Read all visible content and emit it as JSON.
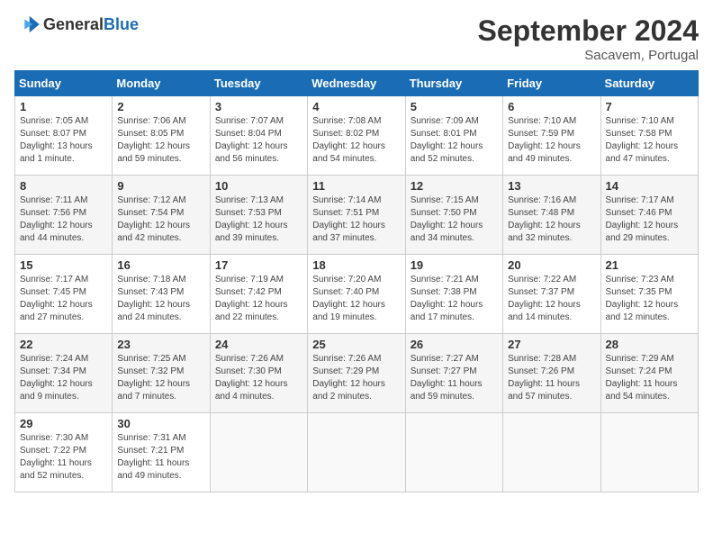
{
  "header": {
    "logo_general": "General",
    "logo_blue": "Blue",
    "month_year": "September 2024",
    "location": "Sacavem, Portugal"
  },
  "days_of_week": [
    "Sunday",
    "Monday",
    "Tuesday",
    "Wednesday",
    "Thursday",
    "Friday",
    "Saturday"
  ],
  "weeks": [
    [
      {
        "day": 1,
        "sunrise": "7:05 AM",
        "sunset": "8:07 PM",
        "daylight": "13 hours and 1 minute."
      },
      {
        "day": 2,
        "sunrise": "7:06 AM",
        "sunset": "8:05 PM",
        "daylight": "12 hours and 59 minutes."
      },
      {
        "day": 3,
        "sunrise": "7:07 AM",
        "sunset": "8:04 PM",
        "daylight": "12 hours and 56 minutes."
      },
      {
        "day": 4,
        "sunrise": "7:08 AM",
        "sunset": "8:02 PM",
        "daylight": "12 hours and 54 minutes."
      },
      {
        "day": 5,
        "sunrise": "7:09 AM",
        "sunset": "8:01 PM",
        "daylight": "12 hours and 52 minutes."
      },
      {
        "day": 6,
        "sunrise": "7:10 AM",
        "sunset": "7:59 PM",
        "daylight": "12 hours and 49 minutes."
      },
      {
        "day": 7,
        "sunrise": "7:10 AM",
        "sunset": "7:58 PM",
        "daylight": "12 hours and 47 minutes."
      }
    ],
    [
      {
        "day": 8,
        "sunrise": "7:11 AM",
        "sunset": "7:56 PM",
        "daylight": "12 hours and 44 minutes."
      },
      {
        "day": 9,
        "sunrise": "7:12 AM",
        "sunset": "7:54 PM",
        "daylight": "12 hours and 42 minutes."
      },
      {
        "day": 10,
        "sunrise": "7:13 AM",
        "sunset": "7:53 PM",
        "daylight": "12 hours and 39 minutes."
      },
      {
        "day": 11,
        "sunrise": "7:14 AM",
        "sunset": "7:51 PM",
        "daylight": "12 hours and 37 minutes."
      },
      {
        "day": 12,
        "sunrise": "7:15 AM",
        "sunset": "7:50 PM",
        "daylight": "12 hours and 34 minutes."
      },
      {
        "day": 13,
        "sunrise": "7:16 AM",
        "sunset": "7:48 PM",
        "daylight": "12 hours and 32 minutes."
      },
      {
        "day": 14,
        "sunrise": "7:17 AM",
        "sunset": "7:46 PM",
        "daylight": "12 hours and 29 minutes."
      }
    ],
    [
      {
        "day": 15,
        "sunrise": "7:17 AM",
        "sunset": "7:45 PM",
        "daylight": "12 hours and 27 minutes."
      },
      {
        "day": 16,
        "sunrise": "7:18 AM",
        "sunset": "7:43 PM",
        "daylight": "12 hours and 24 minutes."
      },
      {
        "day": 17,
        "sunrise": "7:19 AM",
        "sunset": "7:42 PM",
        "daylight": "12 hours and 22 minutes."
      },
      {
        "day": 18,
        "sunrise": "7:20 AM",
        "sunset": "7:40 PM",
        "daylight": "12 hours and 19 minutes."
      },
      {
        "day": 19,
        "sunrise": "7:21 AM",
        "sunset": "7:38 PM",
        "daylight": "12 hours and 17 minutes."
      },
      {
        "day": 20,
        "sunrise": "7:22 AM",
        "sunset": "7:37 PM",
        "daylight": "12 hours and 14 minutes."
      },
      {
        "day": 21,
        "sunrise": "7:23 AM",
        "sunset": "7:35 PM",
        "daylight": "12 hours and 12 minutes."
      }
    ],
    [
      {
        "day": 22,
        "sunrise": "7:24 AM",
        "sunset": "7:34 PM",
        "daylight": "12 hours and 9 minutes."
      },
      {
        "day": 23,
        "sunrise": "7:25 AM",
        "sunset": "7:32 PM",
        "daylight": "12 hours and 7 minutes."
      },
      {
        "day": 24,
        "sunrise": "7:26 AM",
        "sunset": "7:30 PM",
        "daylight": "12 hours and 4 minutes."
      },
      {
        "day": 25,
        "sunrise": "7:26 AM",
        "sunset": "7:29 PM",
        "daylight": "12 hours and 2 minutes."
      },
      {
        "day": 26,
        "sunrise": "7:27 AM",
        "sunset": "7:27 PM",
        "daylight": "11 hours and 59 minutes."
      },
      {
        "day": 27,
        "sunrise": "7:28 AM",
        "sunset": "7:26 PM",
        "daylight": "11 hours and 57 minutes."
      },
      {
        "day": 28,
        "sunrise": "7:29 AM",
        "sunset": "7:24 PM",
        "daylight": "11 hours and 54 minutes."
      }
    ],
    [
      {
        "day": 29,
        "sunrise": "7:30 AM",
        "sunset": "7:22 PM",
        "daylight": "11 hours and 52 minutes."
      },
      {
        "day": 30,
        "sunrise": "7:31 AM",
        "sunset": "7:21 PM",
        "daylight": "11 hours and 49 minutes."
      },
      null,
      null,
      null,
      null,
      null
    ]
  ]
}
